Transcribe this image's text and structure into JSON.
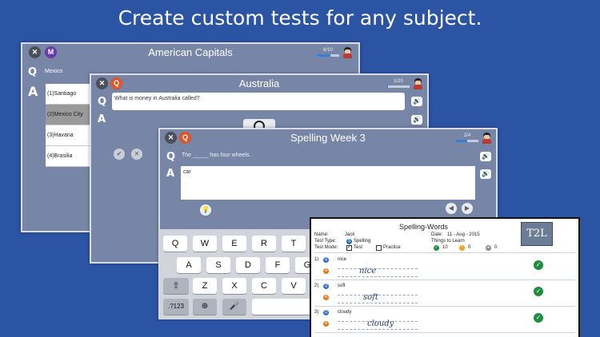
{
  "headline": "Create custom tests for any subject.",
  "card1": {
    "title": "American Capitals",
    "progress": "6/10",
    "progress_fraction": 0.6,
    "question": "Mexico",
    "choices": [
      "(1)Santiago",
      "(2)Mexico City",
      "(3)Havana",
      "(4)Brasilia"
    ],
    "selected_index": 1,
    "badge": "M"
  },
  "card2": {
    "title": "Australia",
    "progress": "1/20",
    "progress_fraction": 0.05,
    "question": "What is money in Australia called?",
    "badge": "Q"
  },
  "card3": {
    "title": "Spelling Week 3",
    "progress": "2/4",
    "progress_fraction": 0.5,
    "question": "The _____ has four wheels.",
    "answer": "car",
    "badge": "Q"
  },
  "labels": {
    "q": "Q",
    "a": "A",
    "close": "✕"
  },
  "keyboard": {
    "row1": [
      "Q",
      "W",
      "E",
      "R",
      "T"
    ],
    "row2": [
      "A",
      "S",
      "D",
      "F",
      "G"
    ],
    "row3": [
      "Z",
      "X",
      "C",
      "V"
    ],
    "shift": "⇧",
    "numbers": ".?123"
  },
  "worksheet": {
    "title": "Spelling-Words",
    "name_label": "Name:",
    "name": "Jack",
    "date_label": "Date:",
    "date": "11 - Aug - 2015",
    "type_label": "Test Type:",
    "type": "Spelling",
    "mode_label": "Test Mode:",
    "mode_test": "Test",
    "mode_practice": "Practice",
    "things_label": "Things to Learn",
    "count_correct": "10",
    "count_partial": "0",
    "count_wrong": "0",
    "logo": "T2L",
    "items": [
      {
        "num": "1)",
        "word": "nice",
        "written": "nice"
      },
      {
        "num": "2)",
        "word": "soft",
        "written": "soft"
      },
      {
        "num": "3)",
        "word": "cloudy",
        "written": "cloudy"
      }
    ]
  }
}
